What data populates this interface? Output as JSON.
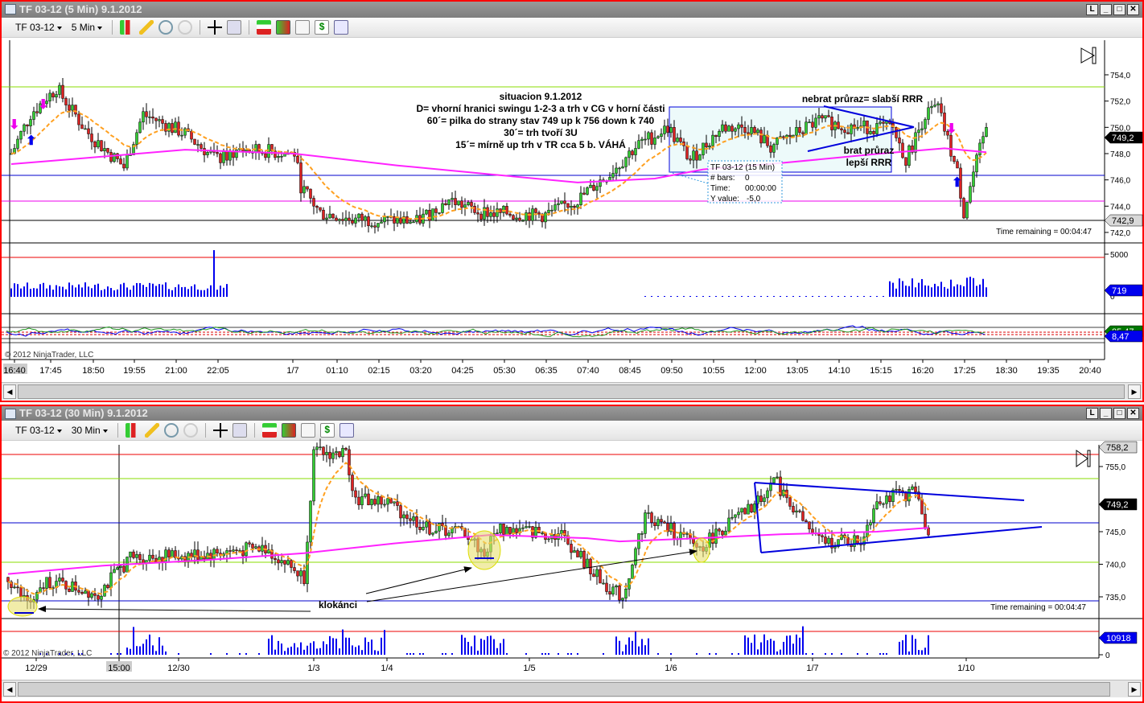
{
  "top_window": {
    "title": "TF 03-12 (5 Min)  9.1.2012",
    "instrument": "TF 03-12",
    "interval": "5 Min",
    "annotation_lines": [
      "situacion 9.1.2012",
      "D= vhorní hranici swingu 1-2-3 a trh v CG v horní části",
      "60´= pilka do strany stav 749 up k 756 down k 740",
      "30´= trh tvoří 3U",
      "15´= mírně up trh v TR cca 5 b. VÁHÁ"
    ],
    "note_top": "nebrat průraz= slabší RRR",
    "note_bottom_1": "brat průraz",
    "note_bottom_2": "lepší RRR",
    "tooltip": {
      "title": "TF 03-12 (15 Min)",
      "bars_label": "# bars:",
      "bars": "0",
      "time_label": "Time:",
      "time": "00:00:00",
      "y_label": "Y value:",
      "y": "-5,0"
    },
    "time_remaining": "Time remaining = 00:04:47",
    "copyright": "© 2012 NinjaTrader, LLC",
    "price_ticks": [
      "754,0",
      "752,0",
      "750,0",
      "748,0",
      "746,0",
      "744,0",
      "742,0"
    ],
    "last_price": "749,2",
    "line_price": "742,9",
    "volume_tick": "5000",
    "volume_zero": "0",
    "volume_last": "719",
    "osc_last_1": "85,47",
    "osc_last_2": "8,47",
    "time_labels": [
      "16:40",
      "17:45",
      "18:50",
      "19:55",
      "21:00",
      "22:05",
      "1/7",
      "01:10",
      "02:15",
      "03:20",
      "04:25",
      "05:30",
      "06:35",
      "07:40",
      "08:45",
      "09:50",
      "10:55",
      "12:00",
      "13:05",
      "14:10",
      "15:15",
      "16:20",
      "17:25",
      "18:30",
      "19:35",
      "20:40"
    ]
  },
  "bottom_window": {
    "title": "TF 03-12 (30 Min)  9.1.2012",
    "instrument": "TF 03-12",
    "interval": "30 Min",
    "label": "klokánci",
    "time_remaining": "Time remaining = 00:04:47",
    "copyright": "© 2012 NinjaTrader, LLC",
    "price_ticks": [
      "755,0",
      "745,0",
      "740,0",
      "735,0"
    ],
    "top_price": "758,2",
    "last_price": "749,2",
    "volume_last": "10918",
    "volume_zero": "0",
    "time_labels": [
      "12/29",
      "15:00",
      "12/30",
      "1/3",
      "1/4",
      "1/5",
      "1/6",
      "1/7",
      "1/10"
    ]
  },
  "colors": {
    "up": "#33cc33",
    "down": "#dd2222",
    "ma_fast": "#ffa020",
    "ma_slow": "#ff22ff",
    "volume": "#0000ee",
    "border": "#ff0000"
  },
  "chart_data": [
    {
      "type": "candlestick",
      "title": "TF 03-12 (5 Min)",
      "ylim": [
        741.5,
        755.5
      ],
      "keypoints_bar_price": [
        [
          0,
          748
        ],
        [
          6,
          751
        ],
        [
          14,
          753
        ],
        [
          24,
          749.5
        ],
        [
          35,
          747
        ],
        [
          41,
          751
        ],
        [
          54,
          749.5
        ],
        [
          64,
          747.5
        ],
        [
          71,
          748.3
        ],
        [
          88,
          748
        ],
        [
          90,
          745.5
        ],
        [
          96,
          743.5
        ],
        [
          106,
          743
        ],
        [
          126,
          742.8
        ],
        [
          136,
          744.5
        ],
        [
          146,
          743.5
        ],
        [
          166,
          743.3
        ],
        [
          176,
          744.5
        ],
        [
          186,
          746.5
        ],
        [
          194,
          748.5
        ],
        [
          204,
          750
        ],
        [
          211,
          747.5
        ],
        [
          221,
          750
        ],
        [
          229,
          750
        ],
        [
          236,
          748.5
        ],
        [
          251,
          750.5
        ],
        [
          261,
          750
        ],
        [
          274,
          750
        ],
        [
          278,
          747.5
        ],
        [
          284,
          751
        ],
        [
          288,
          751.5
        ],
        [
          294,
          746.5
        ],
        [
          296,
          743.5
        ],
        [
          299,
          746.5
        ],
        [
          303,
          750
        ]
      ],
      "hlines": [
        753.1,
        746.3,
        744.4,
        742.9
      ]
    },
    {
      "type": "candlestick",
      "title": "TF 03-12 (30 Min)",
      "ylim": [
        731,
        758.5
      ],
      "keypoints_bar_price": [
        [
          0,
          738
        ],
        [
          4,
          735
        ],
        [
          8,
          734
        ],
        [
          12,
          737.5
        ],
        [
          28,
          735.5
        ],
        [
          38,
          741
        ],
        [
          60,
          741.5
        ],
        [
          80,
          742.5
        ],
        [
          92,
          738
        ],
        [
          95,
          757
        ],
        [
          105,
          757
        ],
        [
          108,
          750
        ],
        [
          118,
          749.5
        ],
        [
          130,
          745.5
        ],
        [
          142,
          745
        ],
        [
          148,
          741.5
        ],
        [
          152,
          745.5
        ],
        [
          172,
          744.5
        ],
        [
          178,
          741
        ],
        [
          185,
          737
        ],
        [
          191,
          735
        ],
        [
          198,
          747.5
        ],
        [
          205,
          745.5
        ],
        [
          215,
          742.5
        ],
        [
          222,
          745.5
        ],
        [
          232,
          749
        ],
        [
          238,
          753
        ],
        [
          248,
          746
        ],
        [
          252,
          743.5
        ],
        [
          265,
          743.5
        ],
        [
          270,
          750
        ],
        [
          282,
          751
        ],
        [
          286,
          745
        ]
      ]
    }
  ]
}
